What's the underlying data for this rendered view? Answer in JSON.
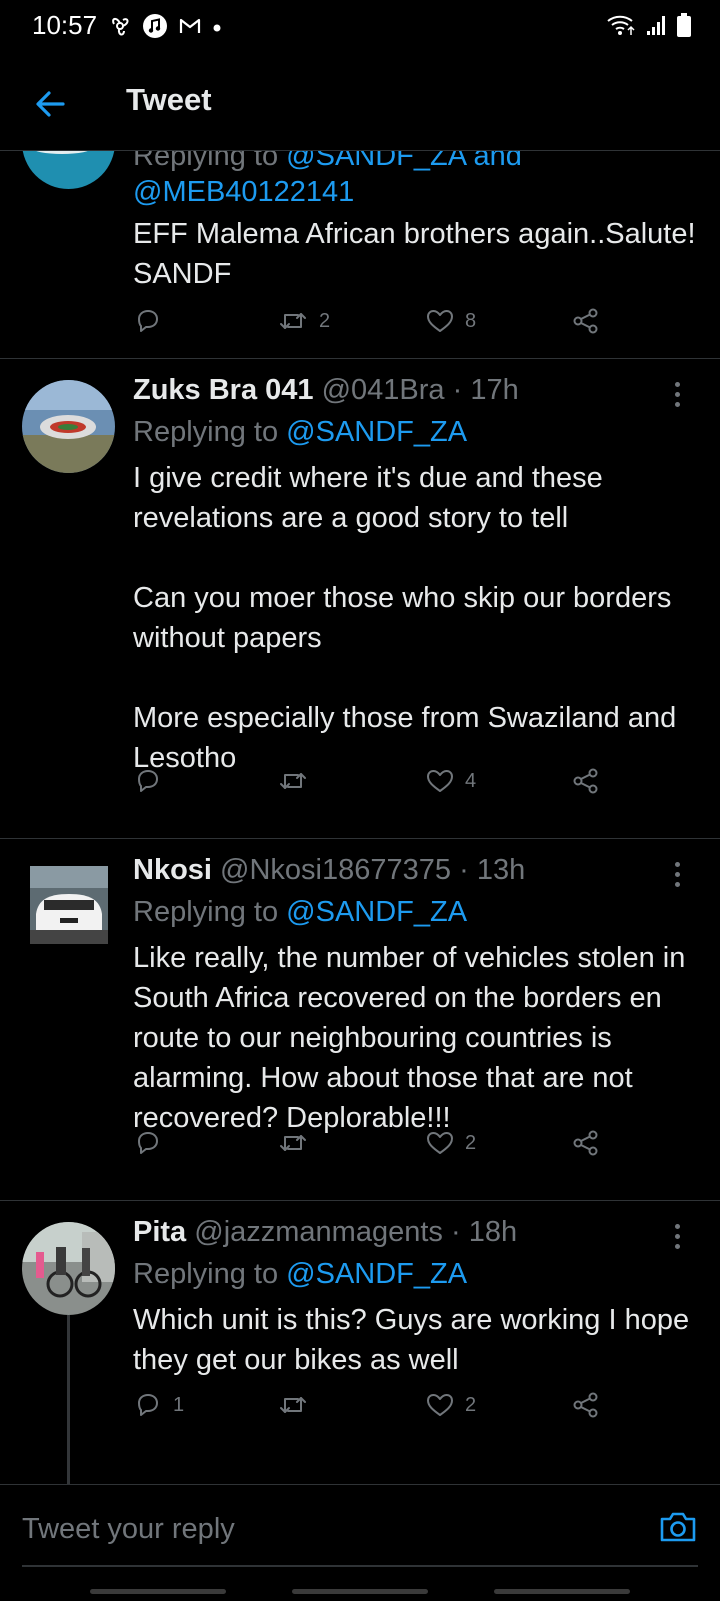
{
  "status_bar": {
    "time": "10:57",
    "left_icons": [
      "fan-icon",
      "music-icon",
      "gmail-icon",
      "dot-icon"
    ],
    "right_icons": [
      "wifi-icon",
      "signal-icon",
      "battery-icon"
    ]
  },
  "header": {
    "title": "Tweet",
    "back_icon": "arrow-left-icon"
  },
  "tweets": [
    {
      "name": "",
      "handle": "",
      "time": "",
      "replying_prefix": "Replying to",
      "replying_to": "@SANDF_ZA and",
      "replying_to_2": "@MEB40122141",
      "paragraphs": [
        "EFF Malema African brothers again..Salute! SANDF"
      ],
      "replies": "",
      "retweets": "2",
      "likes": "8"
    },
    {
      "name": "Zuks Bra 041",
      "handle": "@041Bra",
      "time": "17h",
      "replying_prefix": "Replying to",
      "replying_to": "@SANDF_ZA",
      "paragraphs": [
        "I give credit where it's due and these revelations are a good story to tell",
        "Can you moer those who skip our borders without papers",
        "More especially those from Swaziland and Lesotho"
      ],
      "replies": "",
      "retweets": "",
      "likes": "4"
    },
    {
      "name": "Nkosi",
      "handle": "@Nkosi18677375",
      "time": "13h",
      "replying_prefix": "Replying to",
      "replying_to": "@SANDF_ZA",
      "paragraphs": [
        "Like really, the number of vehicles stolen in South Africa recovered on the borders en route to our neighbouring countries is alarming. How about those that are not recovered? Deplorable!!!"
      ],
      "replies": "",
      "retweets": "",
      "likes": "2"
    },
    {
      "name": "Pita",
      "handle": "@jazzmanmagents",
      "time": "18h",
      "replying_prefix": "Replying to",
      "replying_to": "@SANDF_ZA",
      "paragraphs": [
        "Which unit is this? Guys are working I hope they get our bikes as well"
      ],
      "replies": "1",
      "retweets": "",
      "likes": "2"
    }
  ],
  "reply_bar": {
    "placeholder": "Tweet your reply",
    "camera_icon": "camera-icon"
  },
  "colors": {
    "background": "#000000",
    "accent": "#1d9bf0",
    "secondary_text": "#71767b",
    "divider": "#2f3336"
  }
}
